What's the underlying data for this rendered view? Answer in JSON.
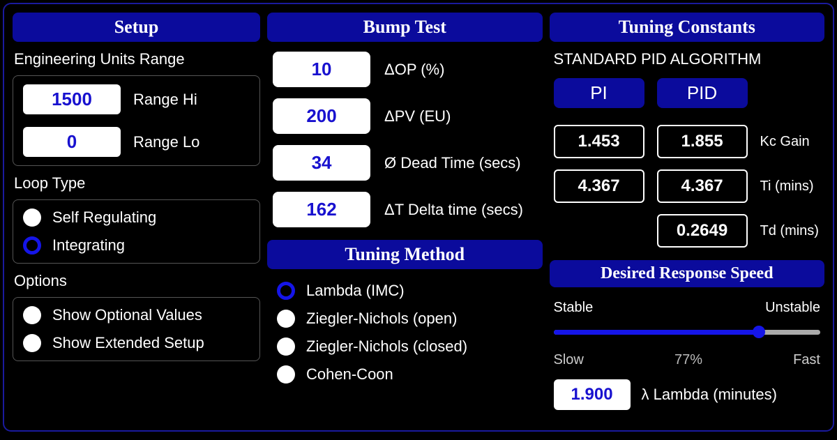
{
  "setup": {
    "header": "Setup",
    "eu_range_label": "Engineering Units Range",
    "range_hi_value": "1500",
    "range_hi_label": "Range Hi",
    "range_lo_value": "0",
    "range_lo_label": "Range Lo",
    "loop_type_label": "Loop Type",
    "loop_types": {
      "self_reg": "Self Regulating",
      "integrating": "Integrating"
    },
    "options_label": "Options",
    "options": {
      "show_optional": "Show Optional Values",
      "show_extended": "Show Extended Setup"
    }
  },
  "bump": {
    "header": "Bump Test",
    "dop_value": "10",
    "dop_label": "ΔOP (%)",
    "dpv_value": "200",
    "dpv_label": "ΔPV (EU)",
    "dead_value": "34",
    "dead_label": "Ø Dead Time (secs)",
    "dt_value": "162",
    "dt_label": "ΔT Delta time (secs)"
  },
  "method": {
    "header": "Tuning Method",
    "options": {
      "lambda": "Lambda (IMC)",
      "zn_open": "Ziegler-Nichols (open)",
      "zn_closed": "Ziegler-Nichols (closed)",
      "cohen": "Cohen-Coon"
    }
  },
  "tuning": {
    "header": "Tuning Constants",
    "algo_label": "STANDARD PID ALGORITHM",
    "pi_btn": "PI",
    "pid_btn": "PID",
    "kc_pi": "1.453",
    "kc_pid": "1.855",
    "kc_label": "Kc Gain",
    "ti_pi": "4.367",
    "ti_pid": "4.367",
    "ti_label": "Ti (mins)",
    "td_pid": "0.2649",
    "td_label": "Td (mins)"
  },
  "response": {
    "header": "Desired Response Speed",
    "stable": "Stable",
    "unstable": "Unstable",
    "slow": "Slow",
    "pct": "77%",
    "fast": "Fast",
    "lambda_value": "1.900",
    "lambda_label": "λ Lambda (minutes)"
  }
}
